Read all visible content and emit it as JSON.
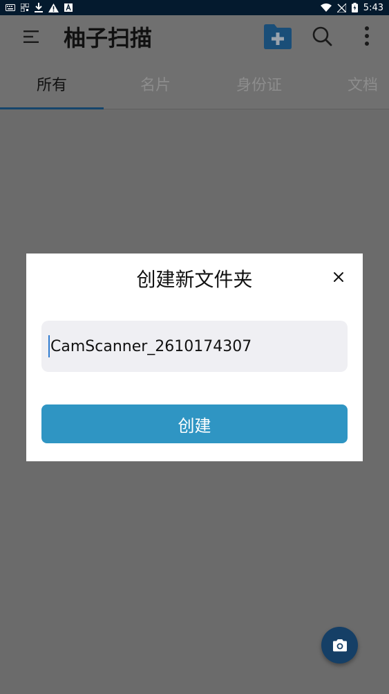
{
  "status_bar": {
    "time": "5:43",
    "icons_left": [
      "keyboard-icon",
      "qr-icon",
      "download-icon",
      "warning-icon",
      "a-badge-icon"
    ],
    "icons_right": [
      "wifi-icon",
      "signal-off-icon",
      "battery-charging-icon"
    ]
  },
  "app_bar": {
    "title": "柚子扫描"
  },
  "tabs": [
    {
      "label": "所有",
      "active": true
    },
    {
      "label": "名片",
      "active": false
    },
    {
      "label": "身份证",
      "active": false
    },
    {
      "label": "文档",
      "active": false
    }
  ],
  "dialog": {
    "title": "创建新文件夹",
    "input_value": "CamScanner_2610174307",
    "create_label": "创建"
  },
  "colors": {
    "accent": "#2f95c3",
    "primary_dark": "#153f66",
    "tab_indicator": "#15456b",
    "scrim": "#6b6b6b"
  }
}
